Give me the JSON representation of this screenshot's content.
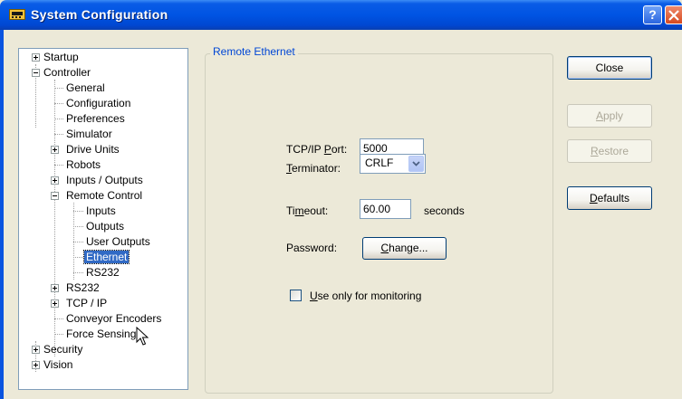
{
  "window": {
    "title": "System Configuration",
    "help_button": "?",
    "close_glyph": "x"
  },
  "tree": {
    "items": [
      {
        "label": "Startup"
      },
      {
        "label": "Controller"
      },
      {
        "label": "General"
      },
      {
        "label": "Configuration"
      },
      {
        "label": "Preferences"
      },
      {
        "label": "Simulator"
      },
      {
        "label": "Drive Units"
      },
      {
        "label": "Robots"
      },
      {
        "label": "Inputs / Outputs"
      },
      {
        "label": "Remote Control"
      },
      {
        "label": "Inputs"
      },
      {
        "label": "Outputs"
      },
      {
        "label": "User Outputs"
      },
      {
        "label": "Ethernet",
        "selected": true
      },
      {
        "label": "RS232"
      },
      {
        "label": "RS232"
      },
      {
        "label": "TCP / IP"
      },
      {
        "label": "Conveyor Encoders"
      },
      {
        "label": "Force Sensing"
      },
      {
        "label": "Security"
      },
      {
        "label": "Vision"
      }
    ]
  },
  "group": {
    "title": "Remote Ethernet"
  },
  "form": {
    "port_label_pre": "TCP/IP ",
    "port_label_u": "P",
    "port_label_post": "ort:",
    "port_value": "5000",
    "terminator_label_u": "T",
    "terminator_label_post": "erminator:",
    "terminator_value": "CRLF",
    "timeout_label_pre": "Ti",
    "timeout_label_u": "m",
    "timeout_label_post": "eout:",
    "timeout_value": "60.00",
    "timeout_unit": "seconds",
    "password_label": "Password:",
    "change_u": "C",
    "change_post": "hange...",
    "monitor_u": "U",
    "monitor_post": "se only for monitoring",
    "monitor_checked": false
  },
  "buttons": {
    "close": "Close",
    "apply_u": "A",
    "apply_post": "pply",
    "restore_u": "R",
    "restore_post": "estore",
    "defaults_u": "D",
    "defaults_post": "efaults"
  },
  "colors": {
    "title_blue": "#0054e3",
    "selection": "#316ac5",
    "group_title": "#0046d5"
  }
}
